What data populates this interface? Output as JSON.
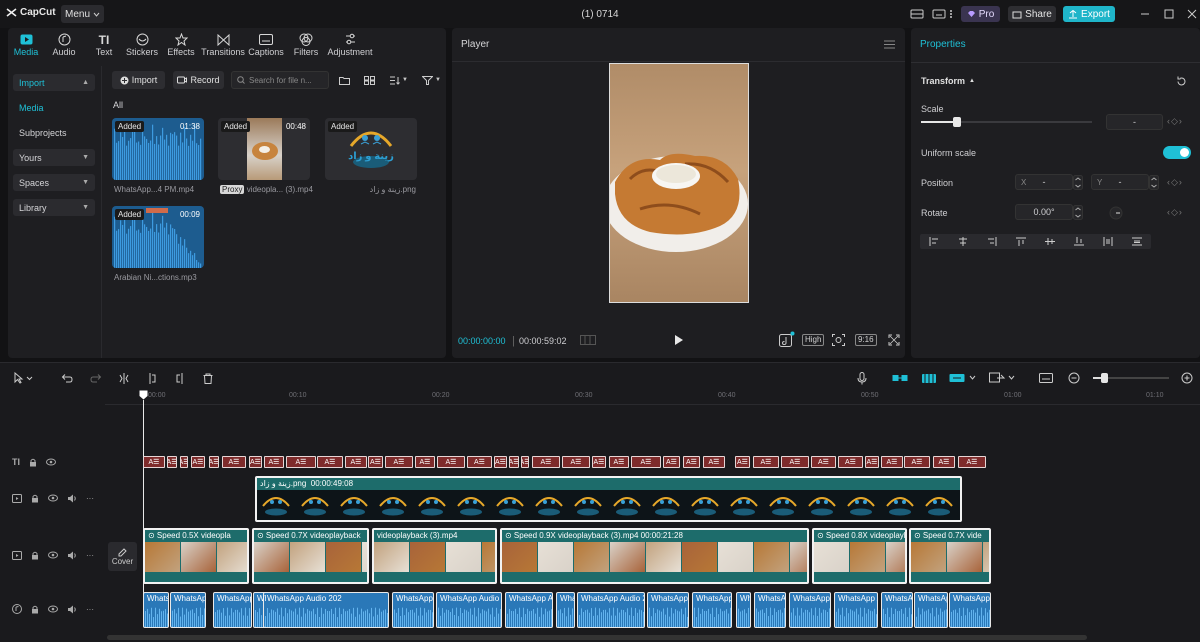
{
  "app": {
    "name": "CapCut",
    "menu_label": "Menu",
    "window_title": "(1) 0714"
  },
  "header": {
    "pro_label": "Pro",
    "share_label": "Share",
    "export_label": "Export"
  },
  "media_tabs": [
    {
      "label": "Media",
      "icon": "media-icon"
    },
    {
      "label": "Audio",
      "icon": "audio-icon"
    },
    {
      "label": "Text",
      "icon": "text-icon"
    },
    {
      "label": "Stickers",
      "icon": "sticker-icon"
    },
    {
      "label": "Effects",
      "icon": "effects-icon"
    },
    {
      "label": "Transitions",
      "icon": "transitions-icon"
    },
    {
      "label": "Captions",
      "icon": "captions-icon"
    },
    {
      "label": "Filters",
      "icon": "filters-icon"
    },
    {
      "label": "Adjustment",
      "icon": "adjustment-icon"
    }
  ],
  "sidebar": {
    "items": [
      "Import",
      "Media",
      "Subprojects",
      "Yours",
      "Spaces",
      "Library"
    ]
  },
  "media_toolbar": {
    "import_label": "Import",
    "record_label": "Record",
    "search_placeholder": "Search for file n...",
    "filter_label": "All"
  },
  "media_items": [
    {
      "name": "WhatsApp...4 PM.mp4",
      "duration": "01:38",
      "badge": "Added"
    },
    {
      "name": "videopla... (3).mp4",
      "duration": "00:48",
      "badge": "Added",
      "proxy": "Proxy"
    },
    {
      "name": "زينة و زاد.png",
      "duration": "",
      "badge": "Added",
      "logo_text": "زينة و زاد"
    },
    {
      "name": "Arabian Ni...ctions.mp3",
      "duration": "00:09",
      "badge": "Added"
    }
  ],
  "player": {
    "title": "Player",
    "current_time": "00:00:00:00",
    "total_time": "00:00:59:02",
    "quality": "High",
    "ratio": "9:16"
  },
  "properties": {
    "title": "Properties",
    "section": "Transform",
    "scale_label": "Scale",
    "scale_value": "-",
    "uniform_scale_label": "Uniform scale",
    "uniform_scale_on": true,
    "position_label": "Position",
    "pos_x_label": "X",
    "pos_x_value": "-",
    "pos_y_label": "Y",
    "pos_y_value": "-",
    "rotate_label": "Rotate",
    "rotate_value": "0.00°"
  },
  "timeline": {
    "ruler": [
      "00:00",
      "00:10",
      "00:20",
      "00:30",
      "00:40",
      "00:50",
      "01:00",
      "01:10"
    ],
    "cover_label": "Cover",
    "overlay_clip_label": "زينة و زاد.png",
    "overlay_clip_duration": "00:00:49:08",
    "video_clips": [
      {
        "speed": "Speed 0.5X",
        "name": "videopla"
      },
      {
        "speed": "Speed 0.7X",
        "name": "videoplayback"
      },
      {
        "speed": "",
        "name": "videoplayback (3).mp4"
      },
      {
        "speed": "Speed 0.9X",
        "name": "videoplayback (3).mp4",
        "duration": "00:00:21:28"
      },
      {
        "speed": "Speed 0.8X",
        "name": "videoplayba"
      },
      {
        "speed": "Speed 0.7X",
        "name": "vide"
      }
    ],
    "audio_clip_label": "WhatsApp Audio 202",
    "text_chip_label": "A☰"
  },
  "colors": {
    "accent": "#1fc0d6",
    "text_clip": "#7e2b2b",
    "video_track": "#1d6c6b",
    "audio_clip": "#2a78b8"
  }
}
